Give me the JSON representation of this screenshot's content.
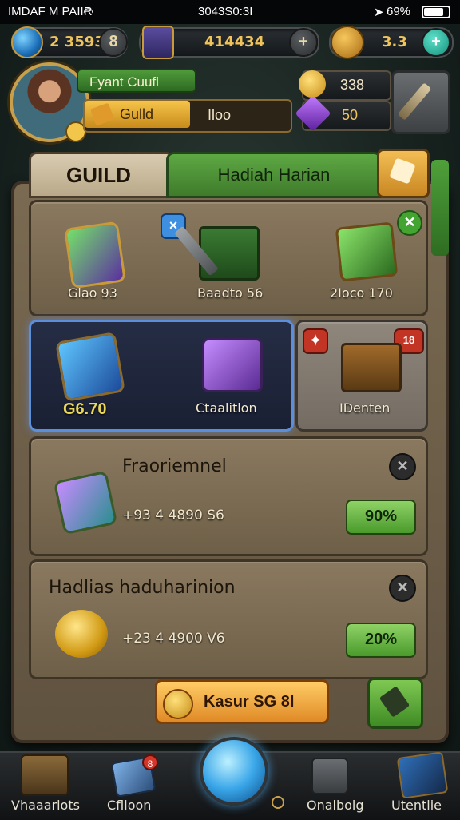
{
  "status_bar": {
    "carrier": "IMDAF M PAIIR",
    "time": "3043S0:3I",
    "battery": "69%"
  },
  "resources": {
    "gems": "2 3593",
    "gems_btn": "8",
    "gold_bar": "414434",
    "gold_btn": "+",
    "shield_value": "3.3",
    "shield_btn": "+"
  },
  "profile": {
    "player_name": "Fyant Cuufl",
    "guild_label": "Gulld",
    "guild_value": "Iloo",
    "coin_value": "338",
    "crystal_value": "50"
  },
  "tabs": {
    "guild": "GUILD",
    "hadiah": "Hadiah Harian"
  },
  "items_row1": [
    {
      "label": "Glao 93"
    },
    {
      "label": "Baadto 56"
    },
    {
      "label": "2Ioco 170"
    }
  ],
  "items_row2": {
    "blue_value": "G6.70",
    "blue_label": "Ctaalitlon",
    "grey_label": "IDenten",
    "grey_badge": "18"
  },
  "rewards": [
    {
      "title": "Fraoriemnel",
      "amount": "+93 4 4890 S6",
      "percent": "90%"
    },
    {
      "title": "Hadlias haduharinion",
      "amount": "+23 4 4900 V6",
      "percent": "20%"
    }
  ],
  "cta": {
    "label": "Kasur SG 8I"
  },
  "nav": [
    {
      "label": "Vhaaarlots"
    },
    {
      "label": "Cflloon",
      "badge": "8"
    },
    {
      "label": "Onalbolg"
    },
    {
      "label": "Utentlie"
    }
  ],
  "colors": {
    "accent_gold": "#f0c45a",
    "accent_green": "#4f9a3a",
    "panel": "#7a6a52",
    "highlight_blue": "#5b8fdb"
  }
}
